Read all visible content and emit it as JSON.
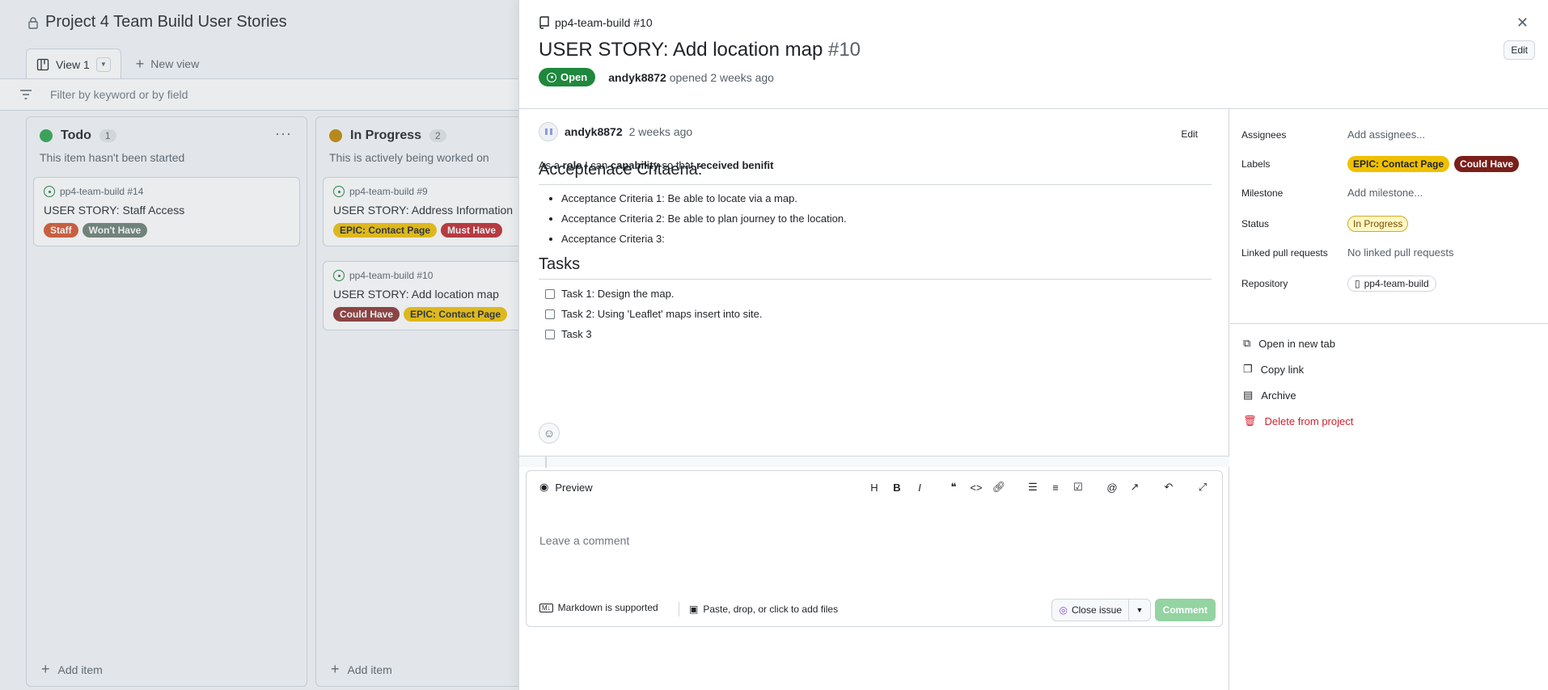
{
  "board": {
    "title": "Project 4 Team Build User Stories",
    "view_tab": "View 1",
    "new_view": "New view",
    "filter_placeholder": "Filter by keyword or by field",
    "columns": [
      {
        "name": "Todo",
        "count": "1",
        "color": "#2da44e",
        "description": "This item hasn't been started",
        "cards": [
          {
            "ref": "pp4-team-build #14",
            "title": "USER STORY: Staff Access",
            "labels": [
              {
                "text": "Staff",
                "color": "#d5542b"
              },
              {
                "text": "Won't Have",
                "color": "#6b7f72"
              }
            ]
          }
        ],
        "add_item": "Add item"
      },
      {
        "name": "In Progress",
        "count": "2",
        "color": "#bf8700",
        "description": "This is actively being worked on",
        "cards": [
          {
            "ref": "pp4-team-build #9",
            "title": "USER STORY: Address Information",
            "labels": [
              {
                "text": "EPIC: Contact Page",
                "color": "#f0c000"
              },
              {
                "text": "Must Have",
                "color": "#c0262d"
              }
            ]
          },
          {
            "ref": "pp4-team-build #10",
            "title": "USER STORY: Add location map",
            "labels": [
              {
                "text": "Could Have",
                "color": "#8b3230"
              },
              {
                "text": "EPIC: Contact Page",
                "color": "#f0c000"
              }
            ]
          }
        ],
        "add_item": "Add item"
      }
    ]
  },
  "panel": {
    "ref": "pp4-team-build #10",
    "title": "USER STORY: Add location map",
    "number": "#10",
    "edit": "Edit",
    "state": "Open",
    "author": "andyk8872",
    "opened": "opened 2 weeks ago",
    "comment": {
      "author": "andyk8872",
      "time": "2 weeks ago",
      "edit": "Edit",
      "text_parts": [
        "As a ",
        "role",
        " I can ",
        "capability",
        " so that ",
        "received benifit"
      ],
      "heading1": "Acceptenace Critaeria:",
      "criteria": [
        "Acceptance Criteria 1: Be able to locate via a map.",
        "Acceptance Criteria 2: Be able to plan journey to the location.",
        "Acceptance Criteria 3:"
      ],
      "heading2": "Tasks",
      "tasks": [
        "Task 1: Design the map.",
        "Task 2: Using 'Leaflet' maps insert into site.",
        "Task 3"
      ]
    },
    "editor": {
      "preview": "Preview",
      "placeholder": "Leave a comment",
      "markdown": "Markdown is supported",
      "paste": "Paste, drop, or click to add files",
      "close_issue": "Close issue",
      "comment": "Comment"
    },
    "sidebar": {
      "assignees_label": "Assignees",
      "assignees_value": "Add assignees...",
      "labels_label": "Labels",
      "labels": [
        {
          "text": "EPIC: Contact Page",
          "color": "#f0c000",
          "fg": "#1f2328"
        },
        {
          "text": "Could Have",
          "color": "#7a1f1a",
          "fg": "#ffffff"
        }
      ],
      "milestone_label": "Milestone",
      "milestone_value": "Add milestone...",
      "status_label": "Status",
      "status_value": "In Progress",
      "linked_label": "Linked pull requests",
      "linked_value": "No linked pull requests",
      "repo_label": "Repository",
      "repo_value": "pp4-team-build",
      "actions": {
        "open_tab": "Open in new tab",
        "copy": "Copy link",
        "archive": "Archive",
        "delete": "Delete from project"
      }
    }
  }
}
